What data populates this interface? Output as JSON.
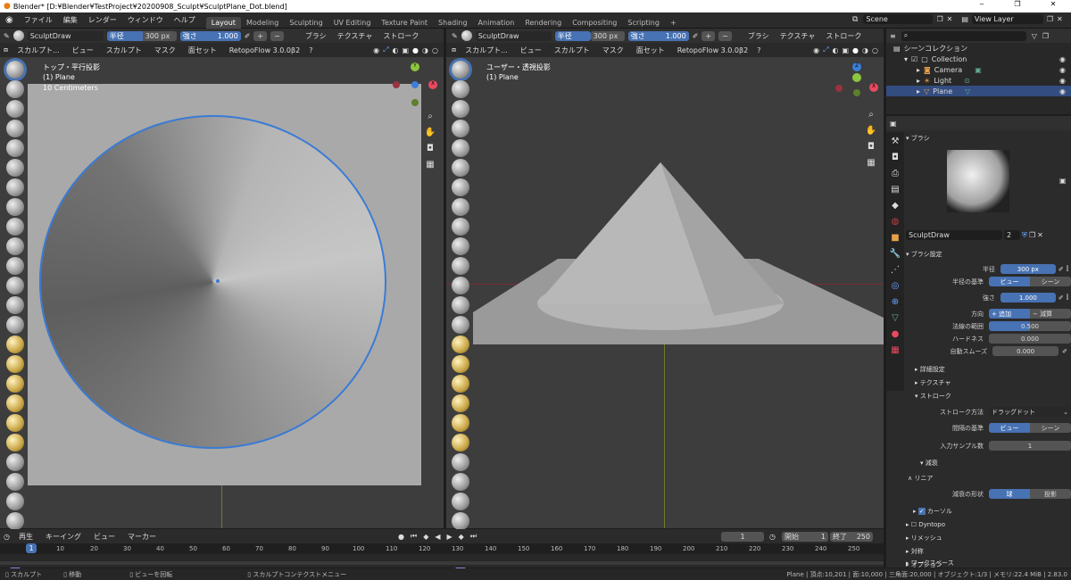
{
  "title_bar": {
    "text": "Blender* [D:¥Blender¥TestProject¥20200908_Sculpt¥SculptPlane_Dot.blend]",
    "controls": [
      "‒",
      "❐",
      "✕"
    ]
  },
  "menu": {
    "items": [
      "ファイル",
      "編集",
      "レンダー",
      "ウィンドウ",
      "ヘルプ"
    ]
  },
  "workspaces": [
    "Layout",
    "Modeling",
    "Sculpting",
    "UV Editing",
    "Texture Paint",
    "Shading",
    "Animation",
    "Rendering",
    "Compositing",
    "Scripting",
    "+"
  ],
  "scene": {
    "name": "Scene",
    "view_layer": "View Layer"
  },
  "brush_header": {
    "brush_name": "SculptDraw",
    "radius_label": "半径",
    "radius_value": "300 px",
    "strength_label": "強さ",
    "strength_value": "1.000",
    "brush_menu": "ブラシ",
    "texture_menu": "テクスチャ",
    "stroke_menu": "ストローク"
  },
  "brush_header_right": {
    "brush_name": "SculptDraw",
    "radius_label": "半径",
    "radius_value": "300 px",
    "strength_label": "強さ",
    "strength_value": "1.000",
    "brush_menu": "ブラシ",
    "texture_menu": "テクスチャ",
    "stroke_menu": "ストローク"
  },
  "viewport_left_header": {
    "mode": "スカルプト...",
    "view": "ビュー",
    "sculpt": "スカルプト",
    "mask": "マスク",
    "face_set": "面セット",
    "addon": "RetopoFlow 3.0.0β2"
  },
  "viewport_right_header": {
    "mode": "スカルプト...",
    "view": "ビュー",
    "sculpt": "スカルプト",
    "mask": "マスク",
    "face_set": "面セット",
    "addon": "RetopoFlow 3.0.0β2"
  },
  "viewport_left": {
    "view_name": "トップ・平行投影",
    "object": "(1) Plane",
    "scale": "10 Centimeters"
  },
  "viewport_right": {
    "view_name": "ユーザー・透視投影",
    "object": "(1) Plane"
  },
  "outliner": {
    "root": "シーンコレクション",
    "items": [
      {
        "name": "Collection",
        "icon": "collection-icon"
      },
      {
        "name": "Camera",
        "icon": "camera-icon"
      },
      {
        "name": "Light",
        "icon": "light-icon"
      },
      {
        "name": "Plane",
        "icon": "mesh-icon"
      }
    ]
  },
  "properties": {
    "brush_section": "ブラシ",
    "brush_name": "SculptDraw",
    "brush_users": "2",
    "brush_settings": "ブラシ設定",
    "radius_label": "半径",
    "radius_value": "300 px",
    "radius_base_label": "半径の基準",
    "radius_base_view": "ビュー",
    "radius_base_scene": "シーン",
    "strength_label": "強さ",
    "strength_value": "1.000",
    "direction_label": "方向",
    "direction_add": "追加",
    "direction_sub": "減算",
    "normal_radius_label": "法線の範囲",
    "normal_radius_value": "0.500",
    "hardness_label": "ハードネス",
    "hardness_value": "0.000",
    "autosmooth_label": "自動スムーズ",
    "autosmooth_value": "0.000",
    "advanced": "詳細設定",
    "texture": "テクスチャ",
    "stroke": "ストローク",
    "stroke_method_label": "ストローク方法",
    "stroke_method_value": "ドラッグドット",
    "spacing_base_label": "間隔の基準",
    "spacing_view": "ビュー",
    "spacing_scene": "シーン",
    "input_samples_label": "入力サンプル数",
    "input_samples_value": "1",
    "falloff": "減衰",
    "falloff_type": "リニア",
    "falloff_shape_label": "減衰の形状",
    "falloff_sphere": "球",
    "falloff_projected": "投影",
    "cursor": "カーソル",
    "dyntopo": "Dyntopo",
    "remesh": "リメッシュ",
    "symmetry": "対称",
    "options": "オプション",
    "workspace": "ワークスペース"
  },
  "timeline": {
    "play_menu": "再生",
    "keying_menu": "キーイング",
    "view_menu": "ビュー",
    "marker_menu": "マーカー",
    "current_frame": "1",
    "start_label": "開始",
    "start_value": "1",
    "end_label": "終了",
    "end_value": "250",
    "ticks": [
      "1",
      "10",
      "20",
      "30",
      "40",
      "50",
      "60",
      "70",
      "80",
      "90",
      "100",
      "110",
      "120",
      "130",
      "140",
      "150",
      "160",
      "170",
      "180",
      "190",
      "200",
      "210",
      "220",
      "230",
      "240",
      "250"
    ]
  },
  "status_bar": {
    "left1": "スカルプト",
    "left2": "移動",
    "left3": "ビューを回転",
    "left4": "スカルプトコンテクストメニュー",
    "right": "Plane | 頂点:10,201 | 面:10,000 | 三角面:20,000 | オブジェクト:1/3 | メモリ:22.4 MiB | 2.83.0"
  }
}
